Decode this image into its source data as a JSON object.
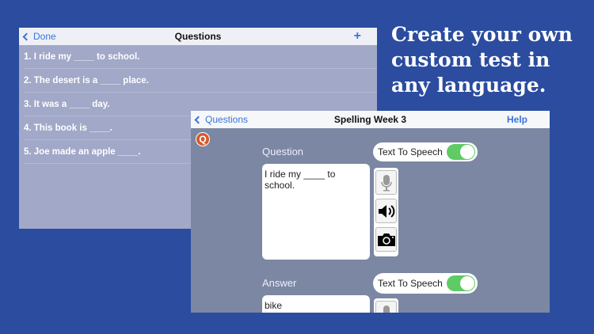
{
  "headline": "Create your own custom test in any language.",
  "list_panel": {
    "back_label": "Done",
    "title": "Questions",
    "add_label": "+",
    "items": [
      "1. I ride my ____ to school.",
      "2. The desert is a ____ place.",
      "3. It was a ____ day.",
      "4. This book is ____.",
      "5. Joe made an apple ____."
    ]
  },
  "editor": {
    "back_label": "Questions",
    "title": "Spelling Week 3",
    "help_label": "Help",
    "badge": "Q",
    "question_label": "Question",
    "question_text": "I ride my ____ to school.",
    "answer_label": "Answer",
    "answer_text": "bike",
    "tts_label": "Text To Speech",
    "tts_question_on": true,
    "tts_answer_on": true
  }
}
